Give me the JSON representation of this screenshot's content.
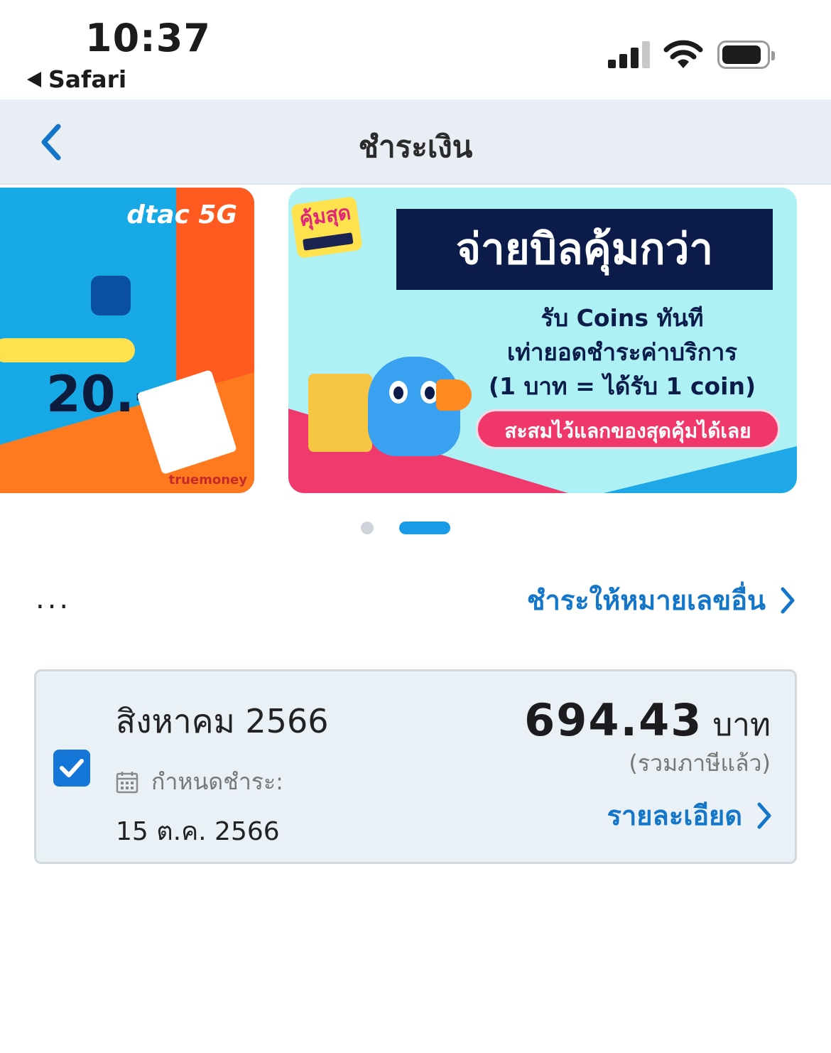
{
  "status_bar": {
    "time": "10:37",
    "back_app_label": "Safari"
  },
  "nav": {
    "title": "ชำระเงิน"
  },
  "carousel": {
    "left_banner": {
      "brand_text": "dtac 5G",
      "amount_text": "20.-",
      "footer_brand": "truemoney"
    },
    "right_banner": {
      "sticker_text": "คุ้มสุด",
      "headline": "จ่ายบิลคุ้มกว่า",
      "line1": "รับ Coins ทันที",
      "line2": "เท่ายอดชำระค่าบริการ",
      "line3": "(1 บาท = ได้รับ 1 coin)",
      "pill_text": "สะสมไว้แลกของสุดคุ้มได้เลย"
    },
    "active_index": 1
  },
  "account": {
    "masked_name": "...",
    "pay_other_label": "ชำระให้หมายเลขอื่น"
  },
  "bill": {
    "checked": true,
    "month": "สิงหาคม 2566",
    "due_label": "กำหนดชำระ:",
    "due_date": "15 ต.ค. 2566",
    "amount": "694.43",
    "currency": "บาท",
    "tax_note": "(รวมภาษีแล้ว)",
    "details_label": "รายละเอียด"
  },
  "colors": {
    "accent": "#1476c9",
    "checkbox": "#1476d6",
    "nav_bg": "#e8eef4",
    "card_bg": "#eaf1f6"
  }
}
